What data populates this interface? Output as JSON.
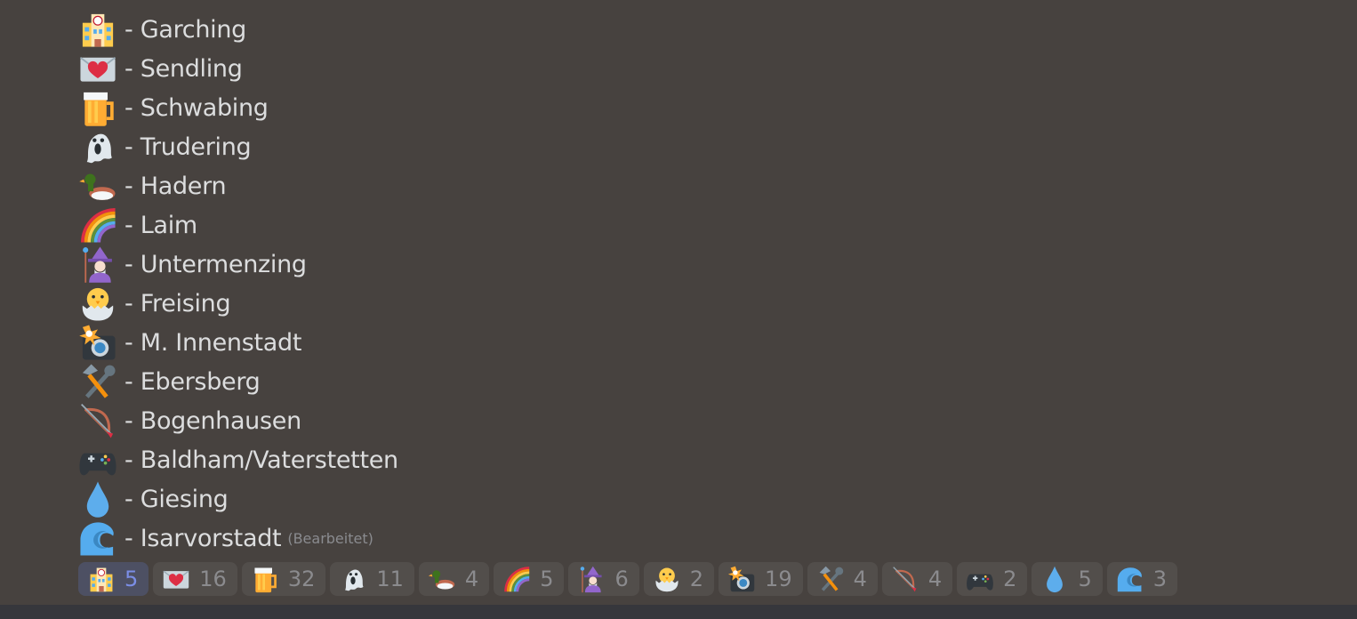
{
  "message": {
    "lines": [
      {
        "icon": "school-icon",
        "text": "- Garching"
      },
      {
        "icon": "love-letter-icon",
        "text": "- Sendling"
      },
      {
        "icon": "beer-icon",
        "text": "- Schwabing"
      },
      {
        "icon": "ghost-icon",
        "text": "- Trudering"
      },
      {
        "icon": "duck-icon",
        "text": "- Hadern"
      },
      {
        "icon": "rainbow-icon",
        "text": "- Laim"
      },
      {
        "icon": "mage-icon",
        "text": "- Untermenzing"
      },
      {
        "icon": "hatching-chick-icon",
        "text": "- Freising"
      },
      {
        "icon": "camera-flash-icon",
        "text": "- M. Innenstadt"
      },
      {
        "icon": "tools-icon",
        "text": "- Ebersberg"
      },
      {
        "icon": "bow-arrow-icon",
        "text": "- Bogenhausen"
      },
      {
        "icon": "game-controller-icon",
        "text": "- Baldham/Vaterstetten"
      },
      {
        "icon": "droplet-icon",
        "text": "- Giesing"
      },
      {
        "icon": "wave-icon",
        "text": "- Isarvorstadt"
      }
    ],
    "edited_label": "(Bearbeitet)"
  },
  "reactions": [
    {
      "icon": "school-icon",
      "count": "5",
      "me": true
    },
    {
      "icon": "love-letter-icon",
      "count": "16"
    },
    {
      "icon": "beer-icon",
      "count": "32"
    },
    {
      "icon": "ghost-icon",
      "count": "11"
    },
    {
      "icon": "duck-icon",
      "count": "4"
    },
    {
      "icon": "rainbow-icon",
      "count": "5"
    },
    {
      "icon": "mage-icon",
      "count": "6"
    },
    {
      "icon": "hatching-chick-icon",
      "count": "2"
    },
    {
      "icon": "camera-flash-icon",
      "count": "19"
    },
    {
      "icon": "tools-icon",
      "count": "4"
    },
    {
      "icon": "bow-arrow-icon",
      "count": "4"
    },
    {
      "icon": "game-controller-icon",
      "count": "2"
    },
    {
      "icon": "droplet-icon",
      "count": "5"
    },
    {
      "icon": "wave-icon",
      "count": "3"
    }
  ],
  "colors": {
    "background": "#47423f",
    "reaction_bg": "#524e4b",
    "reaction_active_bg": "#4d5063",
    "accent": "#7b8ee6"
  }
}
